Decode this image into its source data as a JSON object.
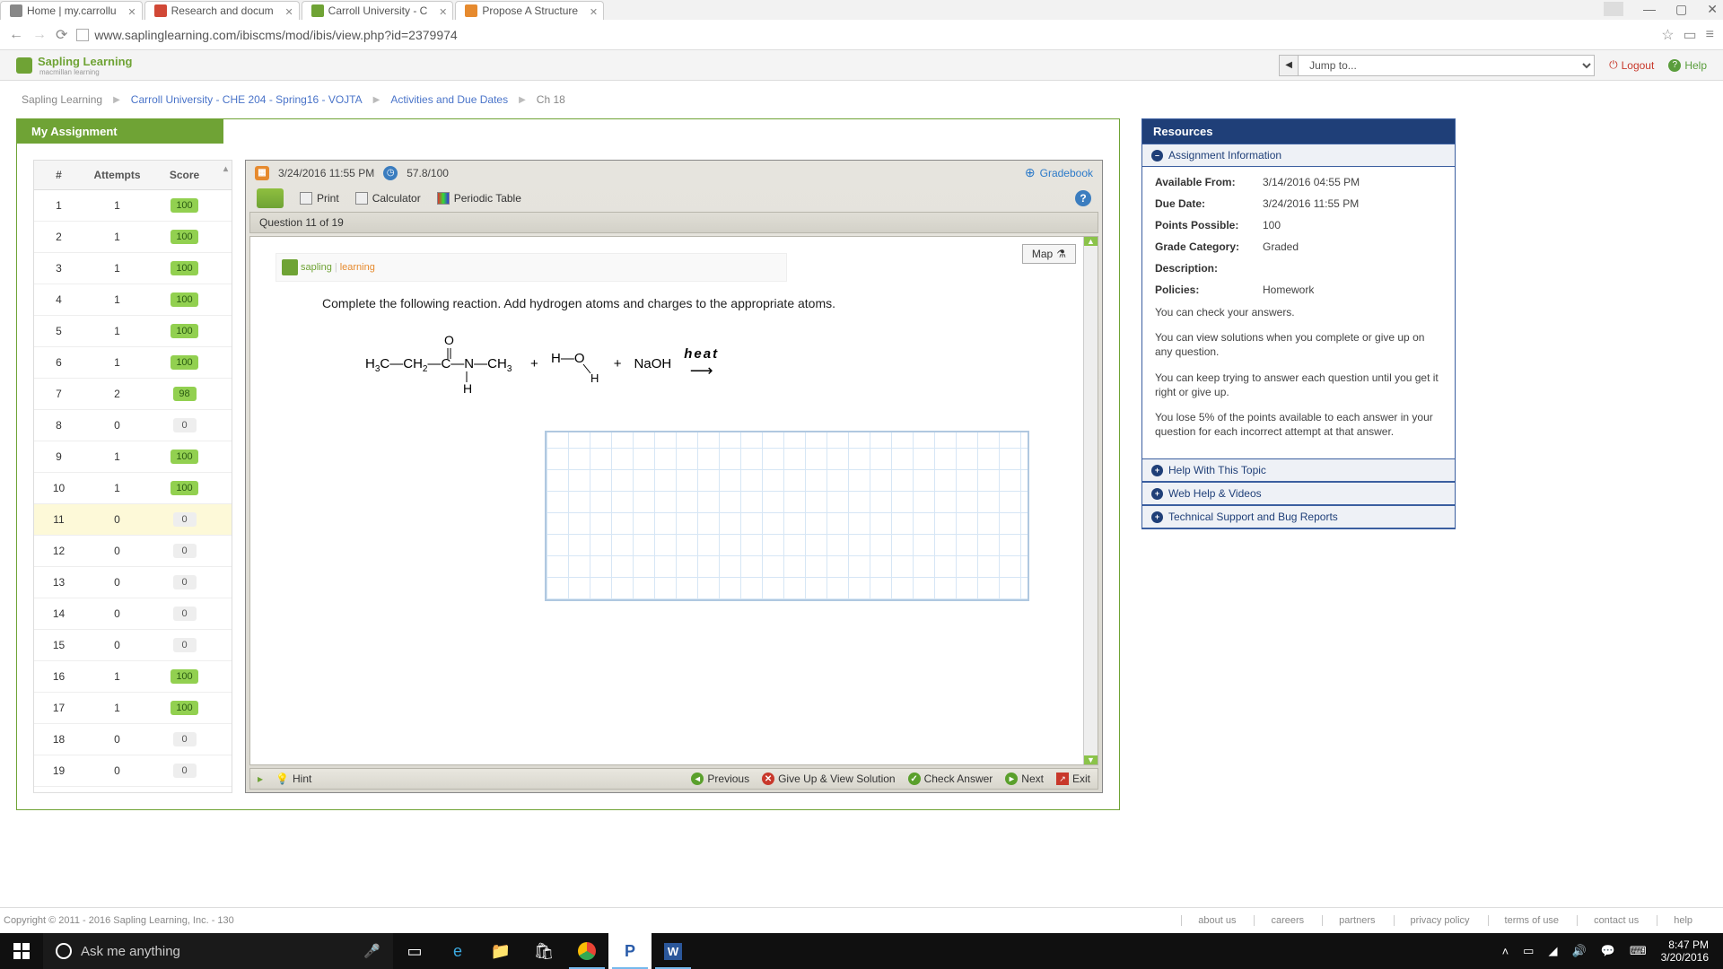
{
  "browser": {
    "tabs": [
      {
        "title": "Home | my.carrollu"
      },
      {
        "title": "Research and docum"
      },
      {
        "title": "Carroll University - C"
      },
      {
        "title": "Propose A Structure"
      }
    ],
    "url": "www.saplinglearning.com/ibiscms/mod/ibis/view.php?id=2379974"
  },
  "header": {
    "brand": "Sapling Learning",
    "brand_sub": "macmillan learning",
    "jump": "Jump to...",
    "logout": "Logout",
    "help": "Help"
  },
  "breadcrumb": {
    "root": "Sapling Learning",
    "course": "Carroll University - CHE 204 - Spring16 - VOJTA",
    "activities": "Activities and Due Dates",
    "ch": "Ch 18"
  },
  "assignment": {
    "title": "My Assignment",
    "col_num": "#",
    "col_att": "Attempts",
    "col_score": "Score",
    "rows": [
      {
        "n": "1",
        "a": "1",
        "s": "100",
        "g": true
      },
      {
        "n": "2",
        "a": "1",
        "s": "100",
        "g": true
      },
      {
        "n": "3",
        "a": "1",
        "s": "100",
        "g": true
      },
      {
        "n": "4",
        "a": "1",
        "s": "100",
        "g": true
      },
      {
        "n": "5",
        "a": "1",
        "s": "100",
        "g": true
      },
      {
        "n": "6",
        "a": "1",
        "s": "100",
        "g": true
      },
      {
        "n": "7",
        "a": "2",
        "s": "98",
        "g": true
      },
      {
        "n": "8",
        "a": "0",
        "s": "0",
        "g": false
      },
      {
        "n": "9",
        "a": "1",
        "s": "100",
        "g": true
      },
      {
        "n": "10",
        "a": "1",
        "s": "100",
        "g": true
      },
      {
        "n": "11",
        "a": "0",
        "s": "0",
        "g": false,
        "active": true
      },
      {
        "n": "12",
        "a": "0",
        "s": "0",
        "g": false
      },
      {
        "n": "13",
        "a": "0",
        "s": "0",
        "g": false
      },
      {
        "n": "14",
        "a": "0",
        "s": "0",
        "g": false
      },
      {
        "n": "15",
        "a": "0",
        "s": "0",
        "g": false
      },
      {
        "n": "16",
        "a": "1",
        "s": "100",
        "g": true
      },
      {
        "n": "17",
        "a": "1",
        "s": "100",
        "g": true
      },
      {
        "n": "18",
        "a": "0",
        "s": "0",
        "g": false
      },
      {
        "n": "19",
        "a": "0",
        "s": "0",
        "g": false
      }
    ]
  },
  "qpane": {
    "due": "3/24/2016 11:55 PM",
    "score": "57.8/100",
    "gradebook": "Gradebook",
    "print": "Print",
    "calculator": "Calculator",
    "ptable": "Periodic Table",
    "qheader": "Question 11 of 19",
    "brand_small": "sapling learning",
    "map": "Map",
    "prompt": "Complete the following reaction. Add hydrogen atoms and charges to the appropriate atoms.",
    "reaction": {
      "r1": "H₃C—CH₂—C(=O)—N(CH₃)—H",
      "plus": "+",
      "r2": "H—O—H",
      "r3": "NaOH",
      "heat": "heat"
    },
    "hint": "Hint",
    "prev": "Previous",
    "giveup": "Give Up & View Solution",
    "check": "Check Answer",
    "next": "Next",
    "exit": "Exit"
  },
  "resources": {
    "title": "Resources",
    "sec_info": "Assignment Information",
    "available_l": "Available From:",
    "available_v": "3/14/2016 04:55 PM",
    "due_l": "Due Date:",
    "due_v": "3/24/2016 11:55 PM",
    "points_l": "Points Possible:",
    "points_v": "100",
    "grade_l": "Grade Category:",
    "grade_v": "Graded",
    "desc_l": "Description:",
    "pol_l": "Policies:",
    "pol_v": "Homework",
    "p1": "You can check your answers.",
    "p2": "You can view solutions when you complete or give up on any question.",
    "p3": "You can keep trying to answer each question until you get it right or give up.",
    "p4": "You lose 5% of the points available to each answer in your question for each incorrect attempt at that answer.",
    "sec_help": "Help With This Topic",
    "sec_web": "Web Help & Videos",
    "sec_tech": "Technical Support and Bug Reports"
  },
  "footer": {
    "copy": "Copyright © 2011 - 2016 Sapling Learning, Inc. - 130",
    "links": [
      "about us",
      "careers",
      "partners",
      "privacy policy",
      "terms of use",
      "contact us",
      "help"
    ]
  },
  "taskbar": {
    "search": "Ask me anything",
    "time": "8:47 PM",
    "date": "3/20/2016"
  }
}
